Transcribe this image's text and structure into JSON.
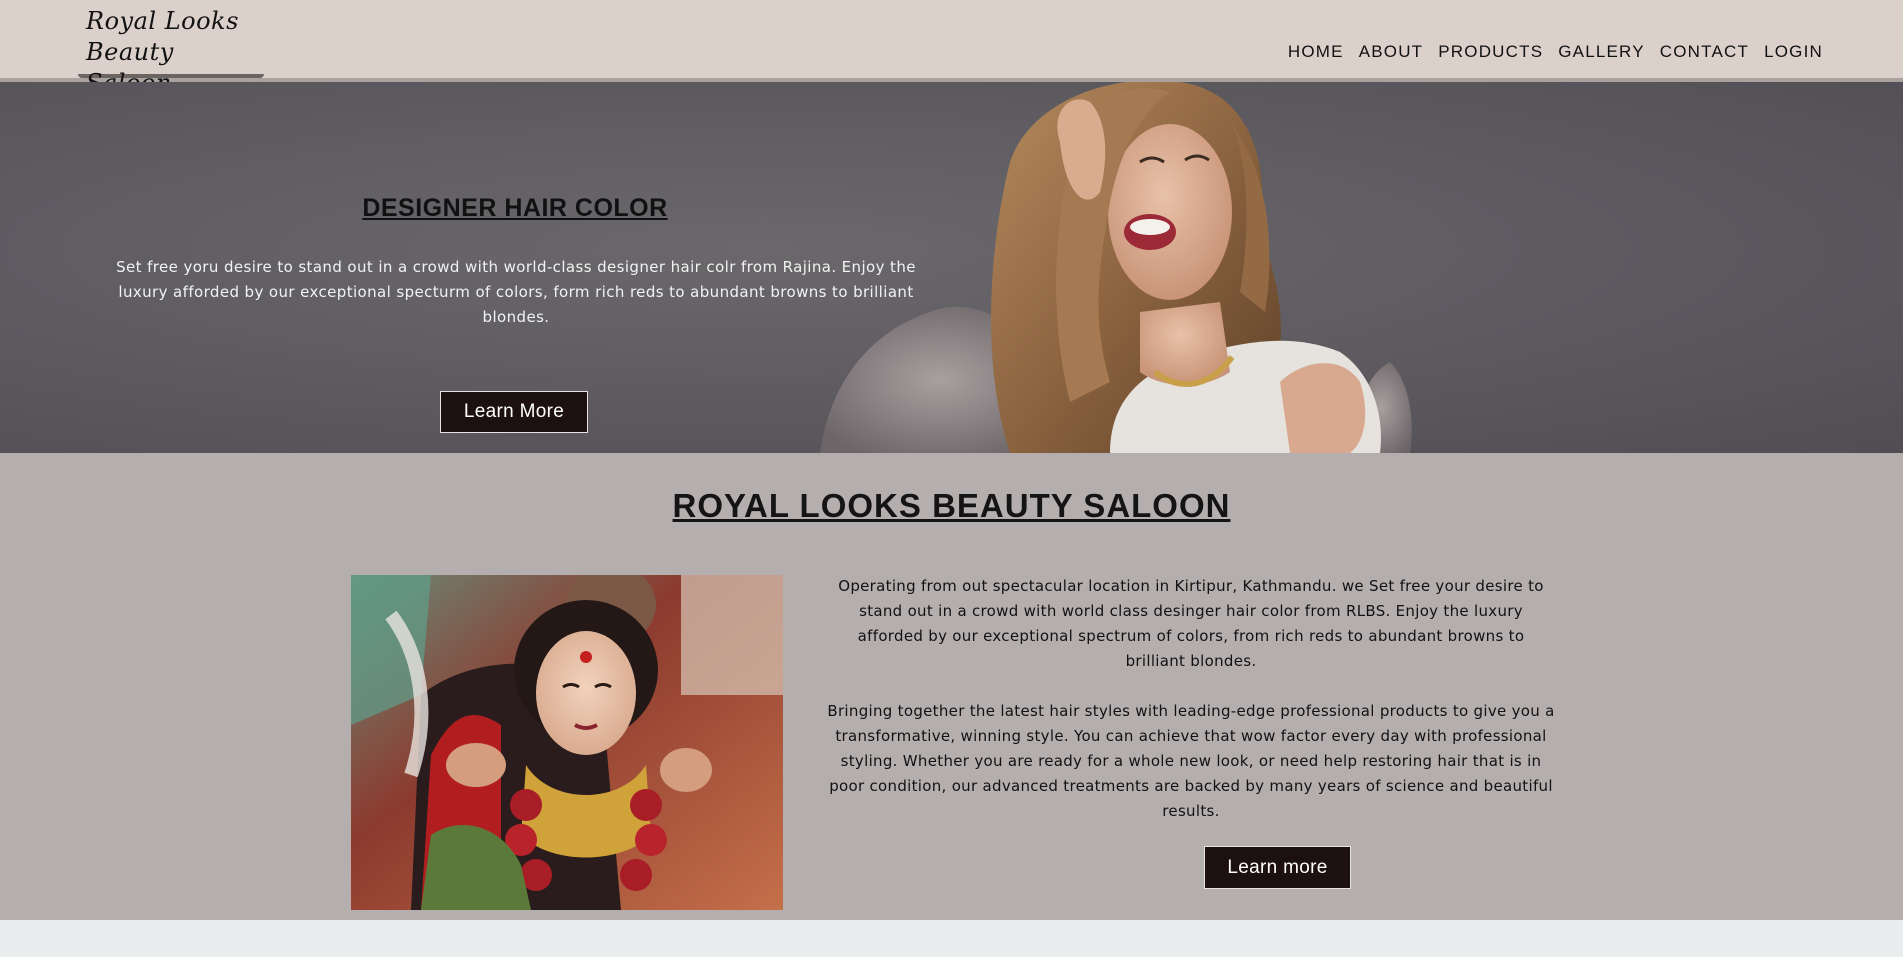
{
  "header": {
    "logo_line1": "Royal Looks",
    "logo_line2": "Beauty Saloon",
    "nav": [
      "HOME",
      "ABOUT",
      "PRODUCTS",
      "GALLERY",
      "CONTACT",
      "LOGIN"
    ]
  },
  "hero": {
    "title": "DESIGNER HAIR COLOR",
    "text": "Set free yoru desire to stand out in a crowd with world-class designer hair colr from Rajina. Enjoy the luxury afforded by our exceptional specturm of colors, form rich reds to abundant browns to brilliant blondes.",
    "button": "Learn More",
    "image": "smiling-model-photo"
  },
  "about": {
    "title": "ROYAL LOOKS BEAUTY SALOON",
    "paragraph1": "Operating from out spectacular location in Kirtipur, Kathmandu. we Set free your desire to stand out in a crowd with world class desinger hair color from RLBS. Enjoy the luxury afforded by our exceptional spectrum of colors, from rich reds to abundant browns to brilliant blondes.",
    "paragraph2": "Bringing together the latest hair styles with leading-edge professional products to give you a transformative, winning style. You can achieve that wow factor every day with professional styling. Whether you are ready for a whole new look, or need help restoring hair that is in poor condition, our advanced treatments are backed by many years of science and beautiful results.",
    "button": "Learn more",
    "image": "bride-photo"
  },
  "colors": {
    "header_bg": "#dcd0cb",
    "hero_bg": "#5f5d62",
    "about_bg": "#b4afae",
    "button_bg": "#1d1011"
  }
}
